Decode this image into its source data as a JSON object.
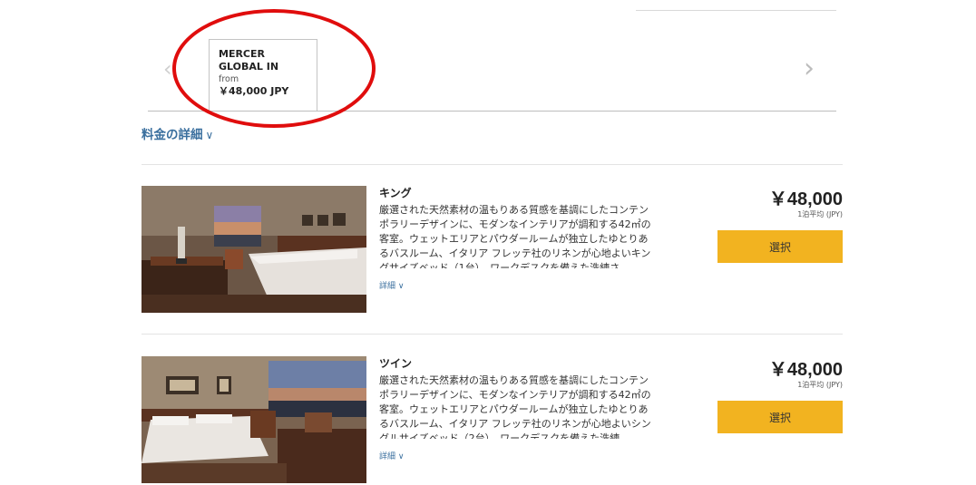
{
  "rate_tabs": {
    "active": {
      "name": "MERCER GLOBAL IN",
      "from_label": "from",
      "price": "￥48,000 JPY"
    },
    "prev_icon": "chevron-left-icon",
    "next_icon": "chevron-right-icon"
  },
  "rate_details_label": "料金の詳細",
  "rooms": [
    {
      "name": "キング",
      "description": "厳選された天然素材の温もりある質感を基調にしたコンテンポラリーデザインに、モダンなインテリアが調和する42㎡の客室。ウェットエリアとパウダールームが独立したゆとりあるバスルーム、イタリア フレッテ社のリネンが心地よいキングサイズベッド（1台）、ワークデスクを備えた洗練さ",
      "more_label": "詳細",
      "price": "￥48,000",
      "price_unit": "1泊平均 (JPY)",
      "select_label": "選択"
    },
    {
      "name": "ツイン",
      "description": "厳選された天然素材の温もりある質感を基調にしたコンテンポラリーデザインに、モダンなインテリアが調和する42㎡の客室。ウェットエリアとパウダールームが独立したゆとりあるバスルーム、イタリア フレッテ社のリネンが心地よいシングルサイズベッド（2台）、ワークデスクを備えた洗練",
      "more_label": "詳細",
      "price": "￥48,000",
      "price_unit": "1泊平均 (JPY)",
      "select_label": "選択"
    }
  ],
  "colors": {
    "accent_button": "#f2b320",
    "link": "#3a6f9e",
    "annotation_circle": "#e00d0d"
  }
}
